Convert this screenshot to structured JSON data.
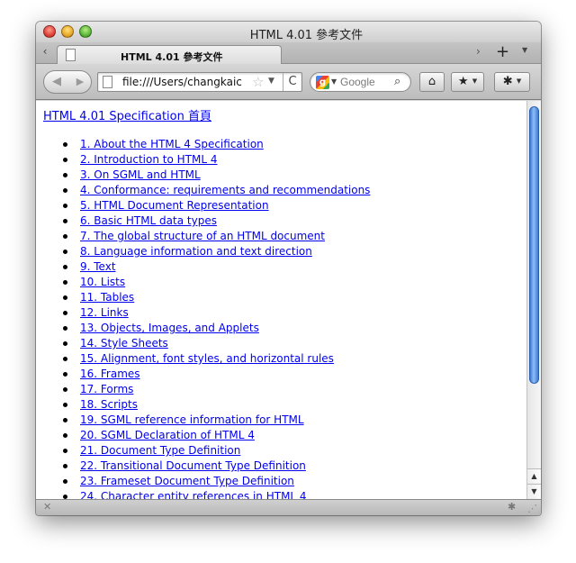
{
  "window": {
    "title": "HTML 4.01 參考文件"
  },
  "tabs": [
    {
      "label": "HTML 4.01 參考文件",
      "active": true
    }
  ],
  "tabstrip": {
    "scroll_left_icon": "‹",
    "scroll_right_icon": "›",
    "new_tab_icon": "+",
    "tab_list_icon": "▼"
  },
  "toolbar": {
    "back_icon": "◀",
    "forward_icon": "▶",
    "url": "file:///Users/changkaic",
    "bookmark_star_icon": "☆",
    "url_dropdown_icon": "▼",
    "reload_icon": "C",
    "search_engine_icon": "g",
    "search_engine_dropdown": "▼",
    "search_placeholder": "Google",
    "search_button_icon": "⌕",
    "home_icon": "⌂",
    "bookmarks_icon": "★",
    "addon_icon": "✱",
    "dropdown_arrow": "▼"
  },
  "content": {
    "title_link": "HTML 4.01 Specification 首頁",
    "toc": [
      "1. About the HTML 4 Specification",
      "2. Introduction to HTML 4",
      "3. On SGML and HTML",
      "4. Conformance: requirements and recommendations",
      "5. HTML Document Representation",
      "6. Basic HTML data types",
      "7. The global structure of an HTML document",
      "8. Language information and text direction",
      "9. Text",
      "10. Lists",
      "11. Tables",
      "12. Links",
      "13. Objects, Images, and Applets",
      "14. Style Sheets",
      "15. Alignment, font styles, and horizontal rules",
      "16. Frames",
      "17. Forms",
      "18. Scripts",
      "19. SGML reference information for HTML",
      "20. SGML Declaration of HTML 4",
      "21. Document Type Definition",
      "22. Transitional Document Type Definition",
      "23. Frameset Document Type Definition",
      "24. Character entity references in HTML 4"
    ]
  },
  "scrollbar": {
    "up_icon": "▲",
    "down_icon": "▼"
  },
  "statusbar": {
    "close_icon": "✕",
    "addon_icon": "✱",
    "resize_icon": "⋰"
  },
  "colors": {
    "link": "#0000ee",
    "scroll_thumb": "#3e7bd6"
  }
}
